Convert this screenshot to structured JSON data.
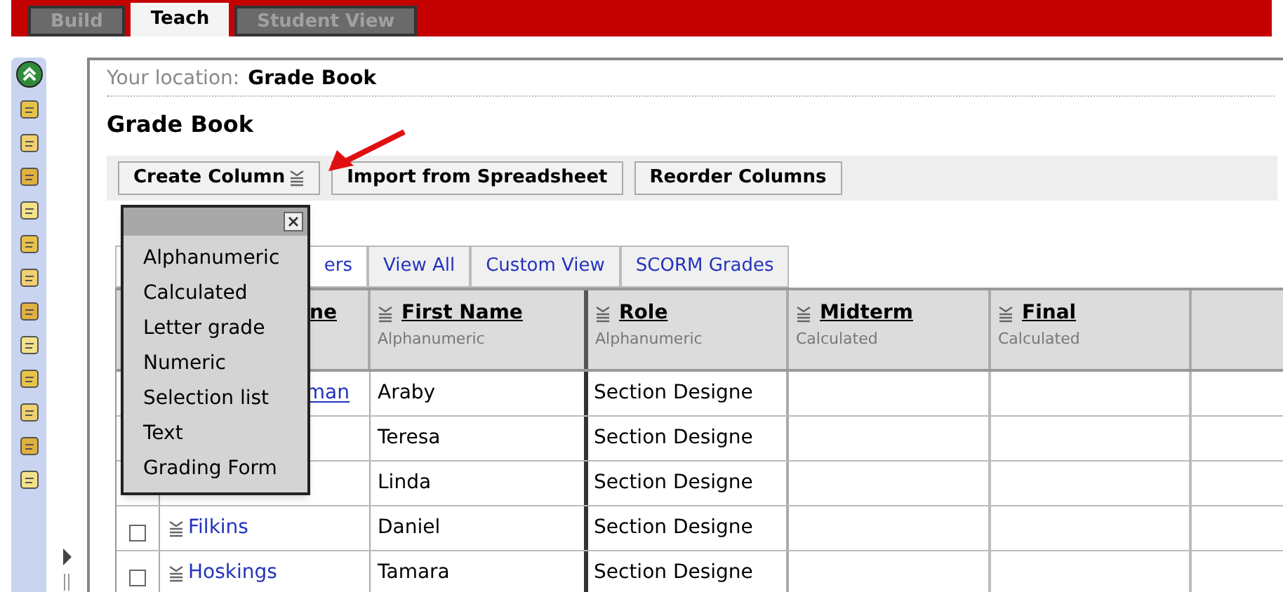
{
  "top_tabs": [
    {
      "label": "Build",
      "selected": false
    },
    {
      "label": "Teach",
      "selected": true
    },
    {
      "label": "Student View",
      "selected": false
    }
  ],
  "location": {
    "label": "Your location:",
    "value": "Grade Book"
  },
  "title": "Grade Book",
  "toolbar": [
    {
      "label": "Create Column",
      "menu": true
    },
    {
      "label": "Import from Spreadsheet"
    },
    {
      "label": "Reorder Columns"
    }
  ],
  "view_tabs": [
    {
      "label": "ers",
      "selected": true
    },
    {
      "label": "View All",
      "selected": false
    },
    {
      "label": "Custom View",
      "selected": false
    },
    {
      "label": "SCORM Grades",
      "selected": false
    }
  ],
  "columns": [
    {
      "title": "ne"
    },
    {
      "title": "First Name",
      "subtitle": "Alphanumeric",
      "menu": true
    },
    {
      "title": "Role",
      "subtitle": "Alphanumeric",
      "menu": true
    },
    {
      "title": "Midterm",
      "subtitle": "Calculated",
      "menu": true
    },
    {
      "title": "Final",
      "subtitle": "Calculated",
      "menu": true
    }
  ],
  "rows": [
    {
      "last_name": "man",
      "first_name": "Araby",
      "role": "Section Designe"
    },
    {
      "first_name": "Teresa",
      "role": "Section Designe"
    },
    {
      "first_name": "Linda",
      "role": "Section Designe"
    },
    {
      "checked": false,
      "last_name": "Filkins",
      "menu": true,
      "first_name": "Daniel",
      "role": "Section Designe"
    },
    {
      "checked": false,
      "last_name": "Hoskings",
      "menu": true,
      "first_name": "Tamara",
      "role": "Section Designe"
    }
  ],
  "column_menu": {
    "items": [
      "Alphanumeric",
      "Calculated",
      "Letter grade",
      "Numeric",
      "Selection list",
      "Text",
      "Grading Form"
    ]
  }
}
